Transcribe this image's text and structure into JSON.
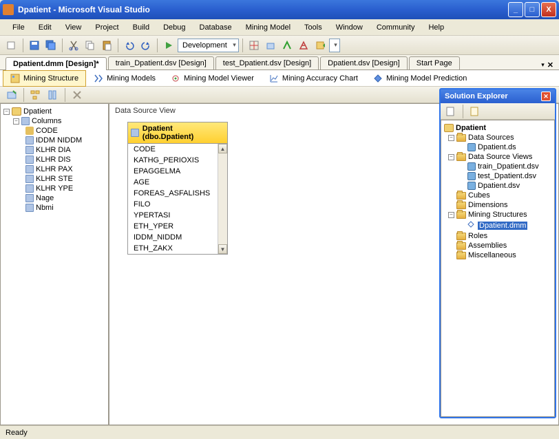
{
  "title": "Dpatient - Microsoft Visual Studio",
  "menu": {
    "file": "File",
    "edit": "Edit",
    "view": "View",
    "project": "Project",
    "build": "Build",
    "debug": "Debug",
    "database": "Database",
    "mining_model": "Mining Model",
    "tools": "Tools",
    "window": "Window",
    "community": "Community",
    "help": "Help"
  },
  "toolbar": {
    "config": "Development"
  },
  "doc_tabs": {
    "t0": "Dpatient.dmm [Design]*",
    "t1": "train_Dpatient.dsv [Design]",
    "t2": "test_Dpatient.dsv [Design]",
    "t3": "Dpatient.dsv [Design]",
    "t4": "Start Page"
  },
  "sub_tabs": {
    "structure": "Mining Structure",
    "models": "Mining Models",
    "viewer": "Mining Model Viewer",
    "accuracy": "Mining Accuracy Chart",
    "prediction": "Mining Model Prediction"
  },
  "tree": {
    "root": "Dpatient",
    "columns": "Columns",
    "items": {
      "i0": "CODE",
      "i1": "IDDM NIDDM",
      "i2": "KLHR DIA",
      "i3": "KLHR DIS",
      "i4": "KLHR PAX",
      "i5": "KLHR STE",
      "i6": "KLHR YPE",
      "i7": "Nage",
      "i8": "Nbmi"
    }
  },
  "dsv": {
    "label": "Data Source View",
    "table_name": "Dpatient (dbo.Dpatient)",
    "cols": {
      "c0": "CODE",
      "c1": "KATHG_PERIOXIS",
      "c2": "EPAGGELMA",
      "c3": "AGE",
      "c4": "FOREAS_ASFALISHS",
      "c5": "FILO",
      "c6": "YPERTASI",
      "c7": "ETH_YPER",
      "c8": "IDDM_NIDDM",
      "c9": "ETH_ZAKX"
    }
  },
  "solution": {
    "title": "Solution Explorer",
    "project": "Dpatient",
    "data_sources": "Data Sources",
    "ds_item": "Dpatient.ds",
    "dsv_folder": "Data Source Views",
    "dsv_items": {
      "d0": "train_Dpatient.dsv",
      "d1": "test_Dpatient.dsv",
      "d2": "Dpatient.dsv"
    },
    "cubes": "Cubes",
    "dimensions": "Dimensions",
    "mining_structures": "Mining Structures",
    "ms_item": "Dpatient.dmm",
    "roles": "Roles",
    "assemblies": "Assemblies",
    "misc": "Miscellaneous"
  },
  "status": "Ready"
}
